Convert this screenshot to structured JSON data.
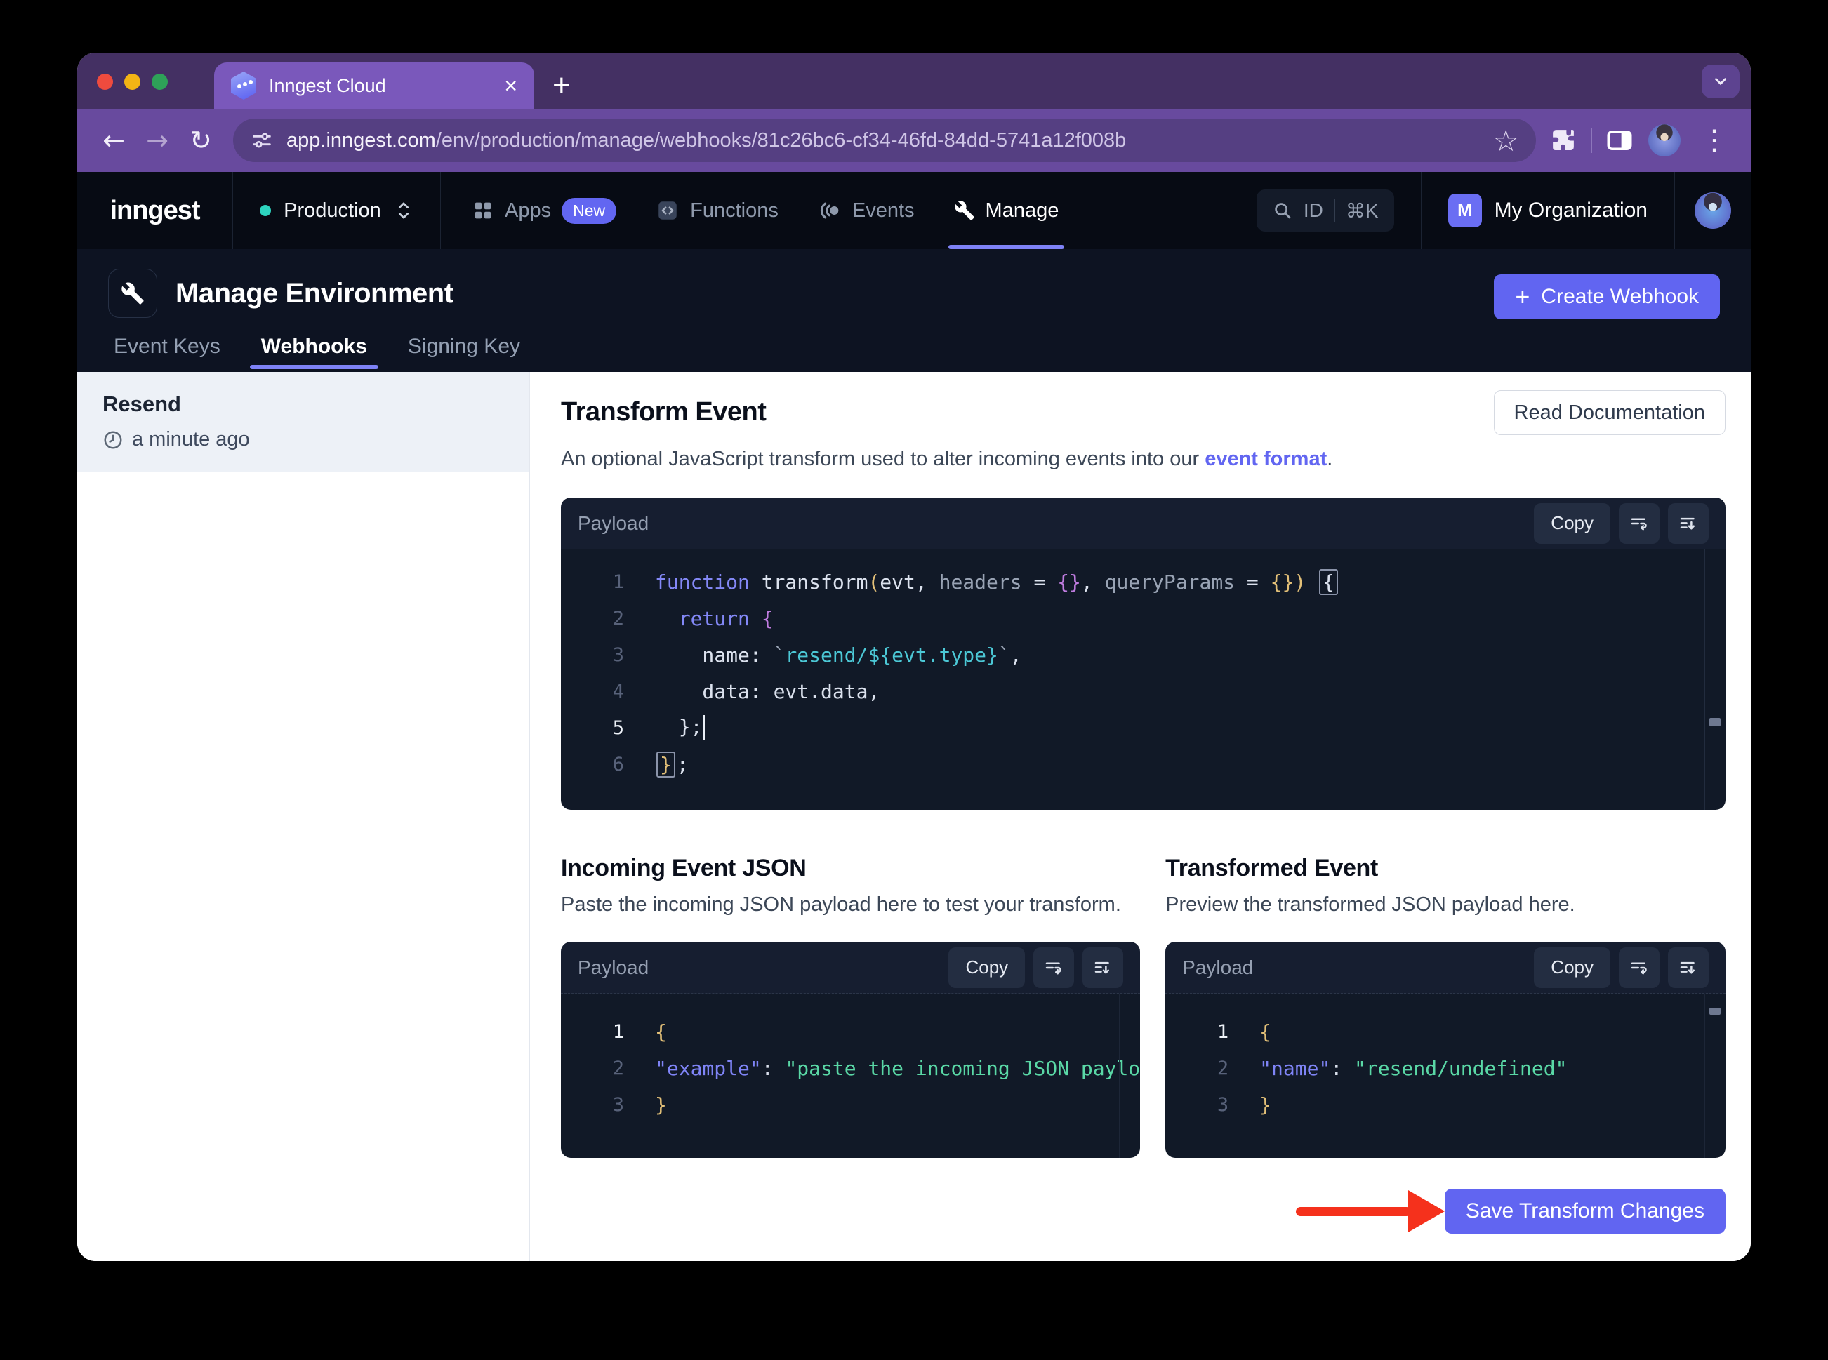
{
  "browser": {
    "tab": {
      "title": "Inngest Cloud"
    },
    "url": {
      "domain": "app.inngest.com",
      "path": "/env/production/manage/webhooks/81c26bc6-cf34-46fd-84dd-5741a12f008b"
    }
  },
  "icons": {
    "back": "←",
    "forward": "→",
    "reload": "↻",
    "star": "☆",
    "kebab": "⋮",
    "close": "×",
    "new_tab": "+"
  },
  "nav": {
    "logo": "inngest",
    "environment": "Production",
    "items": [
      {
        "label": "Apps",
        "badge": "New"
      },
      {
        "label": "Functions"
      },
      {
        "label": "Events"
      },
      {
        "label": "Manage",
        "active": true
      }
    ],
    "search": {
      "label": "ID",
      "shortcut": "⌘K"
    },
    "organization": {
      "badge": "M",
      "name": "My Organization"
    }
  },
  "page_header": {
    "title": "Manage Environment",
    "tabs": [
      {
        "label": "Event Keys"
      },
      {
        "label": "Webhooks",
        "active": true
      },
      {
        "label": "Signing Key"
      }
    ],
    "create_button": {
      "icon": "+",
      "label": "Create Webhook"
    }
  },
  "sidebar": {
    "selected_webhook": {
      "name": "Resend",
      "updated": "a minute ago"
    }
  },
  "transform": {
    "title": "Transform Event",
    "read_docs_button": "Read Documentation",
    "description": {
      "prefix": "An optional JavaScript transform used to alter incoming events into our ",
      "link": "event format",
      "suffix": "."
    },
    "editor": {
      "title": "Payload",
      "copy_button": "Copy",
      "lines": [
        {
          "n": "1",
          "tokens": [
            [
              "kw",
              "function"
            ],
            [
              "tx",
              " transform"
            ],
            [
              "yl",
              "("
            ],
            [
              "tx",
              "evt, "
            ],
            [
              "gy",
              "headers"
            ],
            [
              "tx",
              " = "
            ],
            [
              "pu",
              "{}"
            ],
            [
              "tx",
              ", "
            ],
            [
              "gy",
              "queryParams"
            ],
            [
              "tx",
              " = "
            ],
            [
              "yl",
              "{}"
            ],
            [
              "yl",
              ")"
            ],
            [
              "tx",
              " "
            ],
            [
              "boxw",
              "{"
            ]
          ]
        },
        {
          "n": "2",
          "tokens": [
            [
              "tx",
              "  "
            ],
            [
              "kw",
              "return"
            ],
            [
              "tx",
              " "
            ],
            [
              "pu",
              "{"
            ]
          ]
        },
        {
          "n": "3",
          "tokens": [
            [
              "tx",
              "    name: "
            ],
            [
              "gy",
              "`"
            ],
            [
              "tl",
              "resend/${evt.type}"
            ],
            [
              "gy",
              "`"
            ],
            [
              "tx",
              ","
            ]
          ]
        },
        {
          "n": "4",
          "tokens": [
            [
              "tx",
              "    data: evt.data,"
            ]
          ]
        },
        {
          "n": "5",
          "active": true,
          "tokens": [
            [
              "tx",
              "  };"
            ],
            [
              "cursor",
              ""
            ]
          ]
        },
        {
          "n": "6",
          "tokens": [
            [
              "boxy",
              "}"
            ],
            [
              "tx",
              ";"
            ]
          ]
        }
      ]
    }
  },
  "incoming": {
    "title": "Incoming Event JSON",
    "description": "Paste the incoming JSON payload here to test your transform.",
    "panel": {
      "title": "Payload",
      "copy_button": "Copy",
      "lines": [
        {
          "n": "1",
          "active": true,
          "tokens": [
            [
              "yl",
              "{"
            ]
          ]
        },
        {
          "n": "2",
          "tokens": [
            [
              "key",
              "\"example\""
            ],
            [
              "tx",
              ": "
            ],
            [
              "gr",
              "\"paste the incoming JSON paylo"
            ]
          ]
        },
        {
          "n": "3",
          "tokens": [
            [
              "yl",
              "}"
            ]
          ]
        }
      ]
    }
  },
  "transformed": {
    "title": "Transformed Event",
    "description": "Preview the transformed JSON payload here.",
    "panel": {
      "title": "Payload",
      "copy_button": "Copy",
      "lines": [
        {
          "n": "1",
          "active": true,
          "tokens": [
            [
              "yl",
              "{"
            ]
          ]
        },
        {
          "n": "2",
          "tokens": [
            [
              "key",
              "\"name\""
            ],
            [
              "tx",
              ": "
            ],
            [
              "gr",
              "\"resend/undefined\""
            ]
          ]
        },
        {
          "n": "3",
          "tokens": [
            [
              "yl",
              "}"
            ]
          ]
        }
      ]
    }
  },
  "save_button": "Save Transform Changes",
  "colors": {
    "accent_indigo": "#6165f1",
    "tab_underline": "#7e82f6",
    "env_dot_teal": "#2dd4bf",
    "arrow_red": "#f5311c",
    "browser_purple": "#684a9e",
    "nav_dark": "#070b14",
    "editor_bg": "#111927",
    "code_keyword": "#8388f6",
    "code_yellow": "#e3c078",
    "code_purple": "#c07ce0",
    "code_teal": "#4cc8d6",
    "code_green": "#5ad8a6",
    "json_key": "#7f84f6"
  }
}
